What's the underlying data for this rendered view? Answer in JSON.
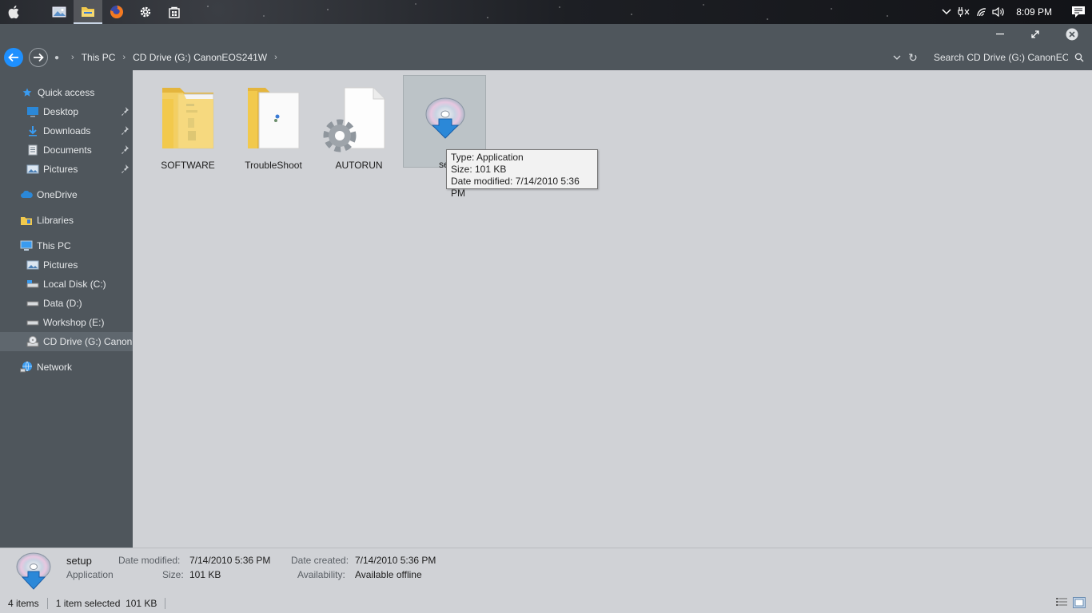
{
  "taskbar": {
    "icons": [
      "apple-icon",
      "photos-icon",
      "file-explorer-icon",
      "firefox-icon",
      "settings-icon",
      "store-icon"
    ],
    "active_index": 2,
    "tray_icons": [
      "chevron-up-icon",
      "power-icon",
      "wifi-icon",
      "volume-icon"
    ],
    "clock": "8:09 PM",
    "notifications_icon": "action-center-icon"
  },
  "window": {
    "controls": [
      "minimize-icon",
      "restore-icon",
      "close-icon"
    ]
  },
  "address_bar": {
    "breadcrumbs": [
      "This PC",
      "CD Drive (G:) CanonEOS241W"
    ],
    "search_placeholder": "Search CD Drive (G:) CanonEO..."
  },
  "sidebar": {
    "items": [
      {
        "label": "Quick access",
        "icon": "star-icon",
        "indent": 0,
        "pinned": false
      },
      {
        "label": "Desktop",
        "icon": "desktop-icon",
        "indent": 1,
        "pinned": true
      },
      {
        "label": "Downloads",
        "icon": "download-icon",
        "indent": 1,
        "pinned": true
      },
      {
        "label": "Documents",
        "icon": "documents-icon",
        "indent": 1,
        "pinned": true
      },
      {
        "label": "Pictures",
        "icon": "pictures-icon",
        "indent": 1,
        "pinned": true
      },
      {
        "label": "OneDrive",
        "icon": "onedrive-icon",
        "indent": 0,
        "pinned": false
      },
      {
        "label": "Libraries",
        "icon": "libraries-icon",
        "indent": 0,
        "pinned": false
      },
      {
        "label": "This PC",
        "icon": "computer-icon",
        "indent": 0,
        "pinned": false
      },
      {
        "label": "Pictures",
        "icon": "pictures-icon",
        "indent": 1,
        "pinned": false
      },
      {
        "label": "Local Disk (C:)",
        "icon": "drive-icon",
        "indent": 1,
        "pinned": false
      },
      {
        "label": "Data (D:)",
        "icon": "drive-icon",
        "indent": 1,
        "pinned": false
      },
      {
        "label": "Workshop (E:)",
        "icon": "drive-icon",
        "indent": 1,
        "pinned": false
      },
      {
        "label": "CD Drive (G:) CanonE",
        "icon": "cd-drive-icon",
        "indent": 1,
        "pinned": false,
        "selected": true
      },
      {
        "label": "Network",
        "icon": "network-icon",
        "indent": 0,
        "pinned": false
      }
    ]
  },
  "files": [
    {
      "name": "SOFTWARE",
      "type": "folder"
    },
    {
      "name": "TroubleShoot",
      "type": "folder"
    },
    {
      "name": "AUTORUN",
      "type": "settings-file"
    },
    {
      "name": "setup",
      "type": "application",
      "selected": true,
      "visible_label": "set"
    }
  ],
  "tooltip": {
    "type_line": "Type: Application",
    "size_line": "Size: 101 KB",
    "date_line": "Date modified: 7/14/2010 5:36 PM"
  },
  "details": {
    "name": "setup",
    "kind": "Application",
    "date_modified_label": "Date modified:",
    "date_modified": "7/14/2010 5:36 PM",
    "size_label": "Size:",
    "size": "101 KB",
    "date_created_label": "Date created:",
    "date_created": "7/14/2010 5:36 PM",
    "availability_label": "Availability:",
    "availability": "Available offline"
  },
  "status": {
    "item_count": "4 items",
    "selection": "1 item selected  101 KB"
  },
  "colors": {
    "accent": "#1e90ff",
    "chrome": "#4f565c",
    "content_bg": "#d0d2d6",
    "folder_yellow": "#f2c94c"
  }
}
